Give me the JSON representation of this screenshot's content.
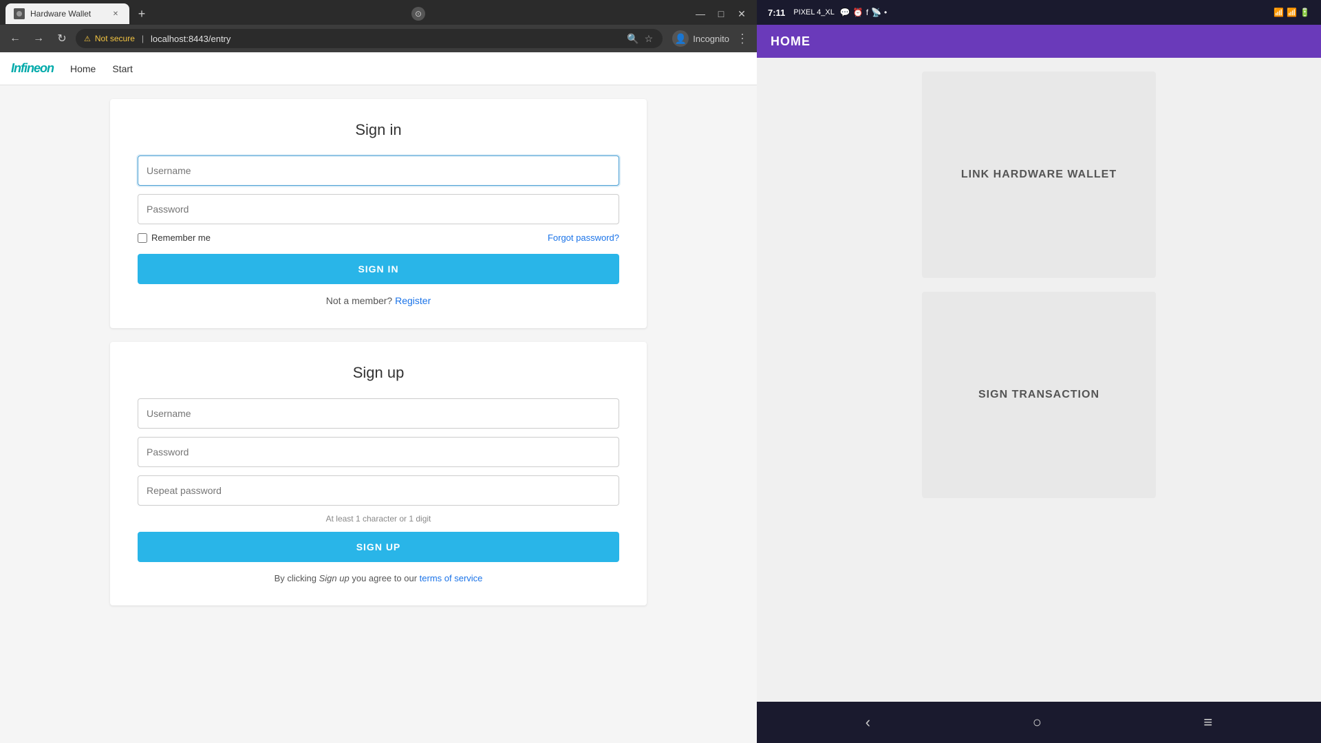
{
  "browser": {
    "tab_title": "Hardware Wallet",
    "new_tab_symbol": "+",
    "win_minimize": "—",
    "win_maximize": "□",
    "win_close": "✕",
    "nav_back": "←",
    "nav_forward": "→",
    "nav_refresh": "↻",
    "security_warning": "Not secure",
    "address": "localhost:8443/entry",
    "search_icon": "🔍",
    "star_icon": "☆",
    "incognito_label": "Incognito",
    "menu_icon": "⋮"
  },
  "navbar": {
    "logo": "Infineon",
    "nav_home": "Home",
    "nav_start": "Start"
  },
  "signin": {
    "title": "Sign in",
    "username_placeholder": "Username",
    "password_placeholder": "Password",
    "remember_label": "Remember me",
    "forgot_label": "Forgot password?",
    "signin_btn": "SIGN IN",
    "not_member": "Not a member?",
    "register_link": "Register"
  },
  "signup": {
    "title": "Sign up",
    "username_placeholder": "Username",
    "password_placeholder": "Password",
    "repeat_password_placeholder": "Repeat password",
    "hint": "At least 1 character or 1 digit",
    "signup_btn": "SIGN UP",
    "terms_prefix": "By clicking",
    "terms_italic": "Sign up",
    "terms_middle": "you agree to our",
    "terms_link": "terms of service"
  },
  "phone": {
    "time": "7:11",
    "model_label": "PIXEL 4_XL",
    "home_label": "HOME",
    "link_wallet_label": "LINK HARDWARE WALLET",
    "sign_transaction_label": "SIGN TRANSACTION",
    "bottom_back": "‹",
    "bottom_home": "○",
    "bottom_menu": "≡"
  }
}
